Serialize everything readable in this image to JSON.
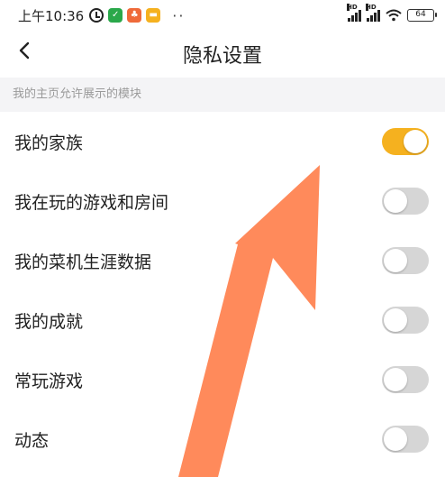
{
  "status_bar": {
    "time": "上午10:36",
    "battery": "64",
    "signal_badge_1": "HD",
    "signal_badge_2": "HD",
    "app_badge_colors": [
      "#2aa84a",
      "#ef6a3a",
      "#f5b11f"
    ]
  },
  "header": {
    "title": "隐私设置"
  },
  "section": {
    "title": "我的主页允许展示的模块"
  },
  "settings": [
    {
      "label": "我的家族",
      "enabled": true
    },
    {
      "label": "我在玩的游戏和房间",
      "enabled": false
    },
    {
      "label": "我的菜机生涯数据",
      "enabled": false
    },
    {
      "label": "我的成就",
      "enabled": false
    },
    {
      "label": "常玩游戏",
      "enabled": false
    },
    {
      "label": "动态",
      "enabled": false
    }
  ],
  "colors": {
    "toggle_on": "#f5b11f",
    "toggle_off": "#d6d6d6",
    "annotation_arrow": "#ff8a5b"
  }
}
